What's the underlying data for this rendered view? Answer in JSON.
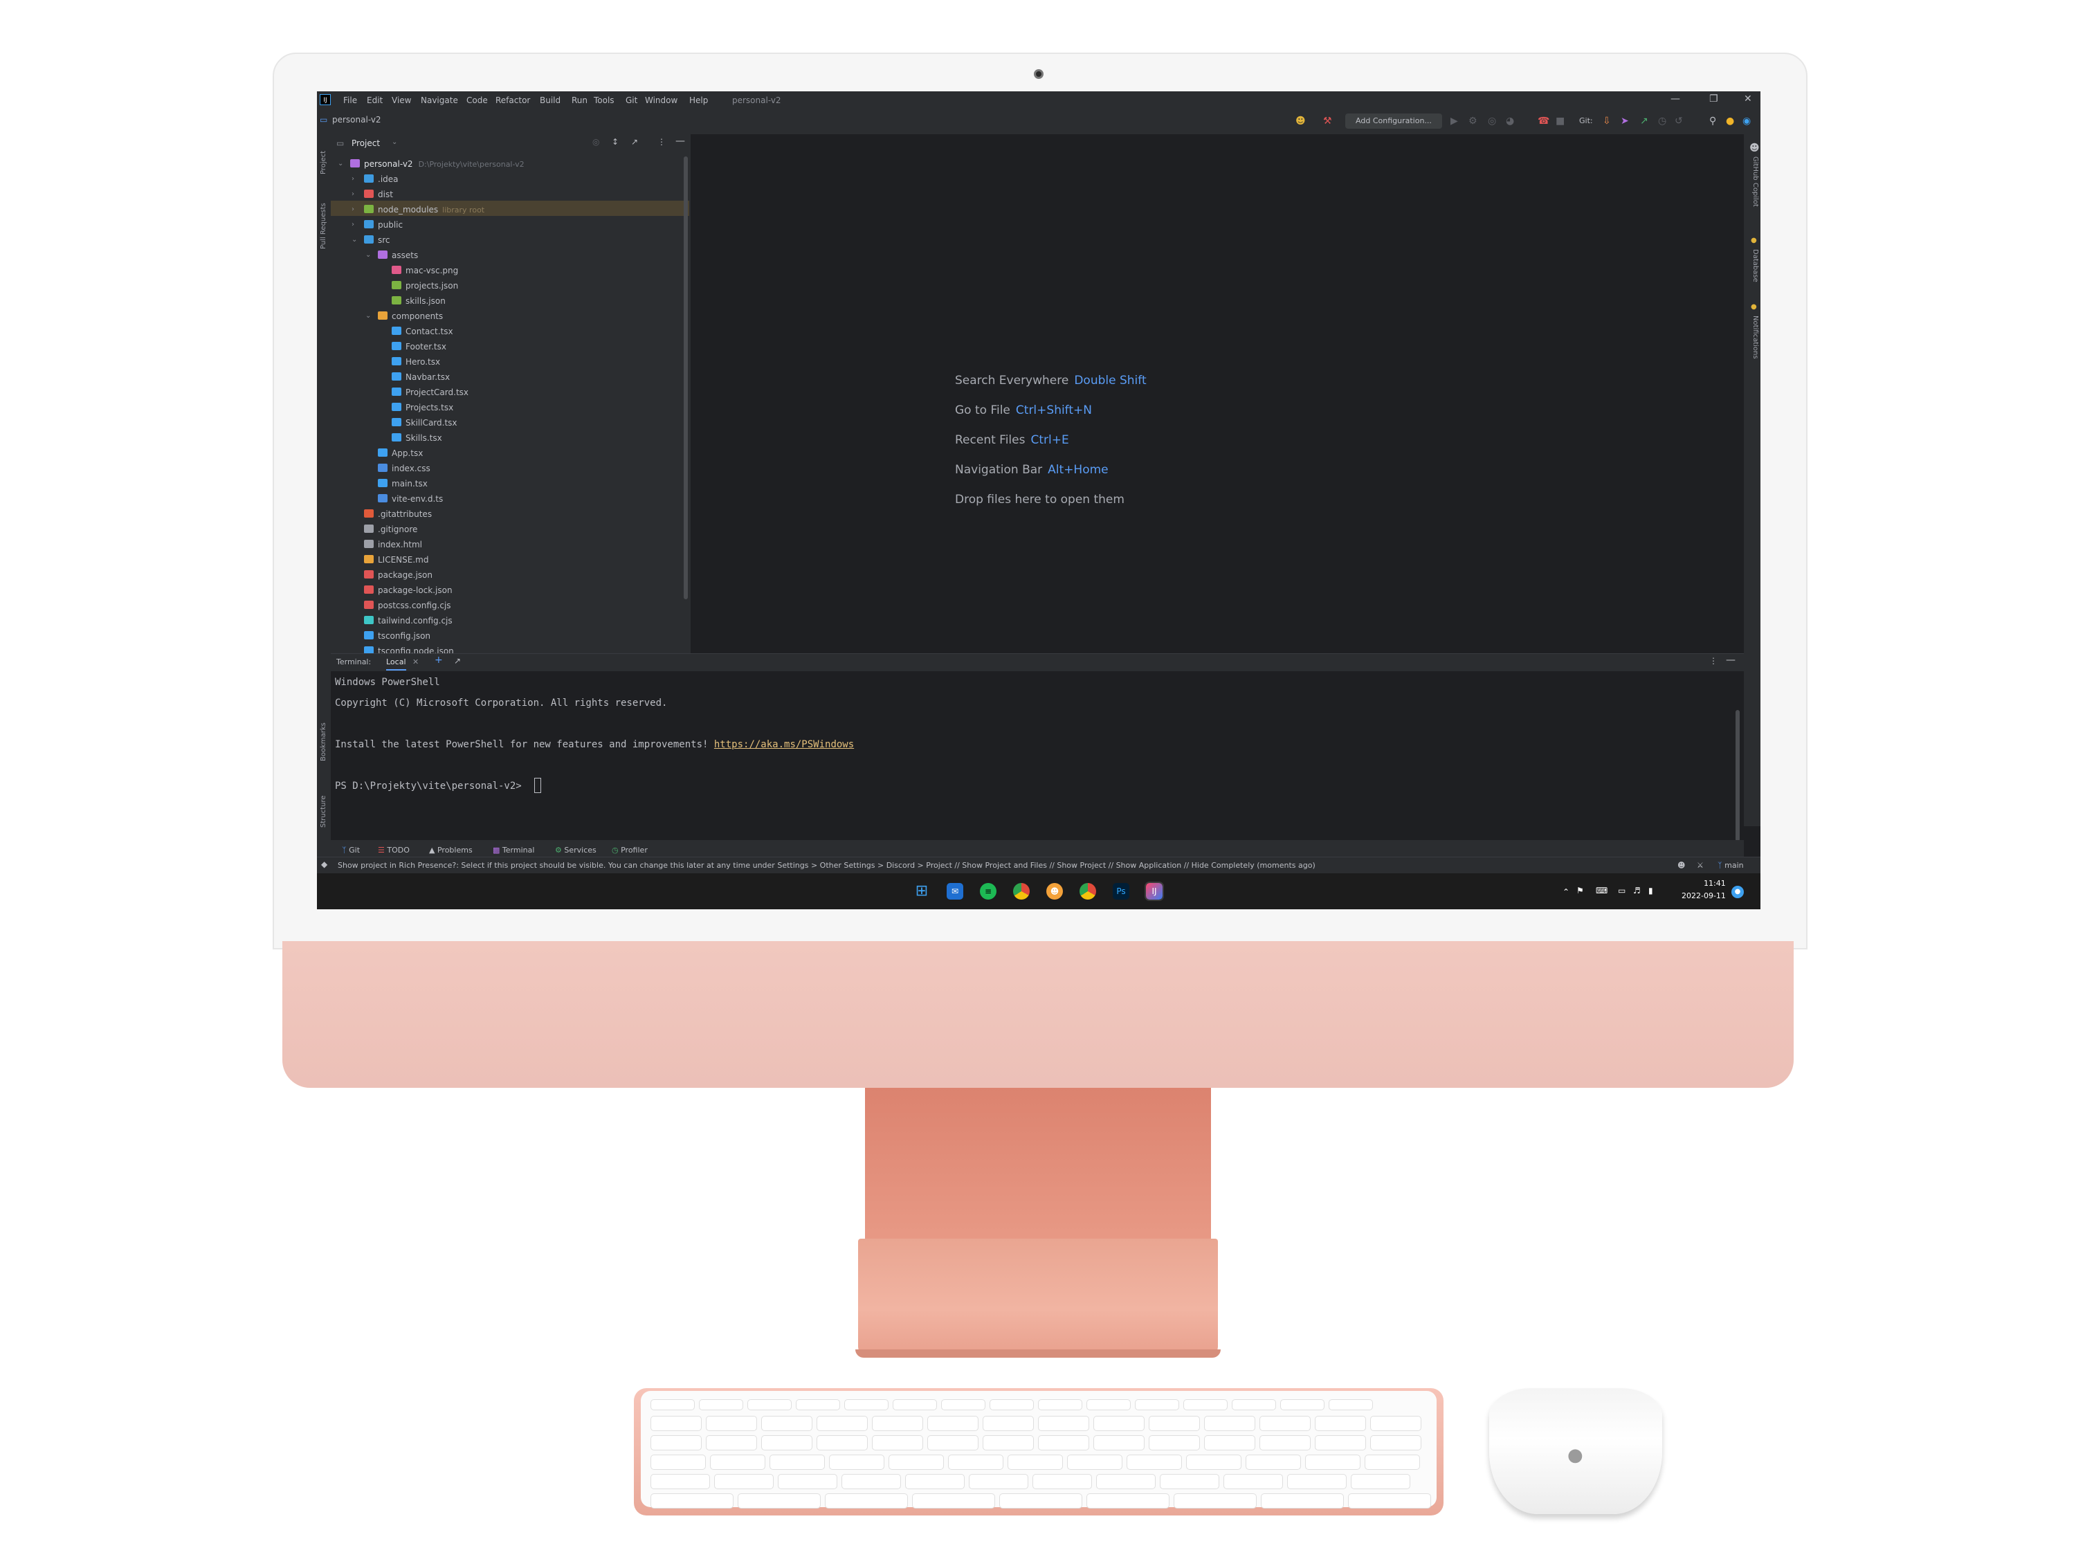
{
  "ide": {
    "title_project": "personal-v2",
    "menu": [
      "File",
      "Edit",
      "View",
      "Navigate",
      "Code",
      "Refactor",
      "Build",
      "Run",
      "Tools",
      "Git",
      "Window",
      "Help"
    ],
    "breadcrumb": "personal-v2",
    "add_configuration": "Add Configuration...",
    "git_label": "Git:"
  },
  "left_stripe": {
    "project": "Project",
    "pull_requests": "Pull Requests",
    "bookmarks": "Bookmarks",
    "structure": "Structure"
  },
  "right_stripe": {
    "copilot": "GitHub Copilot",
    "database": "Database",
    "notifications": "Notifications"
  },
  "project_panel": {
    "title": "Project",
    "root_name": "personal-v2",
    "root_path": "D:\\Projekty\\vite\\personal-v2",
    "library_root": "library root",
    "tree": [
      "personal-v2",
      ".idea",
      "dist",
      "node_modules",
      "public",
      "src",
      "assets",
      "mac-vsc.png",
      "projects.json",
      "skills.json",
      "components",
      "Contact.tsx",
      "Footer.tsx",
      "Hero.tsx",
      "Navbar.tsx",
      "ProjectCard.tsx",
      "Projects.tsx",
      "SkillCard.tsx",
      "Skills.tsx",
      "App.tsx",
      "index.css",
      "main.tsx",
      "vite-env.d.ts",
      ".gitattributes",
      ".gitignore",
      "index.html",
      "LICENSE.md",
      "package.json",
      "package-lock.json",
      "postcss.config.cjs",
      "tailwind.config.cjs",
      "tsconfig.json",
      "tsconfig.node.json"
    ]
  },
  "editor_hints": [
    {
      "label": "Search Everywhere",
      "shortcut": "Double Shift"
    },
    {
      "label": "Go to File",
      "shortcut": "Ctrl+Shift+N"
    },
    {
      "label": "Recent Files",
      "shortcut": "Ctrl+E"
    },
    {
      "label": "Navigation Bar",
      "shortcut": "Alt+Home"
    },
    {
      "label": "Drop files here to open them",
      "shortcut": ""
    }
  ],
  "terminal": {
    "label": "Terminal:",
    "tab": "Local",
    "lines": [
      "Windows PowerShell",
      "Copyright (C) Microsoft Corporation. All rights reserved.",
      "Install the latest PowerShell for new features and improvements! ",
      "PS D:\\Projekty\\vite\\personal-v2> "
    ],
    "link": "https://aka.ms/PSWindows"
  },
  "tool_windows": [
    "Git",
    "TODO",
    "Problems",
    "Terminal",
    "Services",
    "Profiler"
  ],
  "status": {
    "message": "Show project in Rich Presence?: Select if this project should be visible. You can change this later at any time under Settings > Other Settings > Discord > Project // Show Project and Files // Show Project // Show Application // Hide Completely (moments ago)",
    "branch": "main"
  },
  "taskbar": {
    "time": "11:41",
    "date": "2022-09-11",
    "apps": [
      "windows-start-icon",
      "mail-icon",
      "spotify-icon",
      "chrome-icon",
      "discord-icon",
      "chrome-icon",
      "photoshop-icon",
      "intellij-icon"
    ],
    "ps_label": "Ps",
    "ij_label": "IJ"
  },
  "colors": {
    "accent": "#5a9cf5",
    "ide_bg": "#1e1f22",
    "panel_bg": "#2b2d30",
    "imac_pink": "#ecc0b7",
    "stand": "#e29580"
  }
}
